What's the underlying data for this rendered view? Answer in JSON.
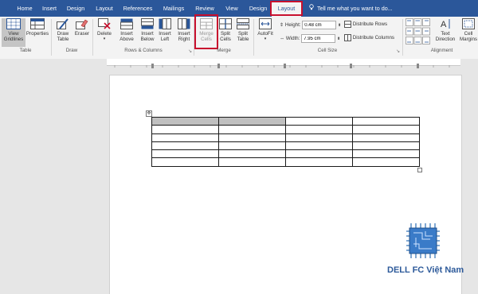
{
  "tabs": [
    {
      "label": "Home"
    },
    {
      "label": "Insert"
    },
    {
      "label": "Design"
    },
    {
      "label": "Layout"
    },
    {
      "label": "References"
    },
    {
      "label": "Mailings"
    },
    {
      "label": "Review"
    },
    {
      "label": "View"
    },
    {
      "label": "Design"
    },
    {
      "label": "Layout"
    }
  ],
  "tell_me": "Tell me what you want to do...",
  "ribbon": {
    "table": {
      "view_gridlines": "View Gridlines",
      "properties": "Properties",
      "label": "Table"
    },
    "draw": {
      "draw_table": "Draw Table",
      "eraser": "Eraser",
      "label": "Draw"
    },
    "rows_columns": {
      "delete": "Delete",
      "insert_above": "Insert Above",
      "insert_below": "Insert Below",
      "insert_left": "Insert Left",
      "insert_right": "Insert Right",
      "label": "Rows & Columns"
    },
    "merge": {
      "merge_cells": "Merge Cells",
      "split_cells": "Split Cells",
      "split_table": "Split Table",
      "label": "Merge"
    },
    "cell_size": {
      "autofit": "AutoFit",
      "height_label": "Height:",
      "height_value": "0.48 cm",
      "width_label": "Width:",
      "width_value": "7.95 cm",
      "distribute_rows": "Distribute Rows",
      "distribute_columns": "Distribute Columns",
      "label": "Cell Size"
    },
    "alignment": {
      "text_direction": "Text Direction",
      "cell_margins": "Cell Margins",
      "label": "Alignment"
    }
  },
  "document": {
    "rows": 6,
    "cols": 4
  },
  "watermark": {
    "brand": "DELL FC Việt Nam"
  },
  "colors": {
    "accent": "#2b579a",
    "highlight": "#c8102e",
    "brand": "#2d5a9a"
  }
}
